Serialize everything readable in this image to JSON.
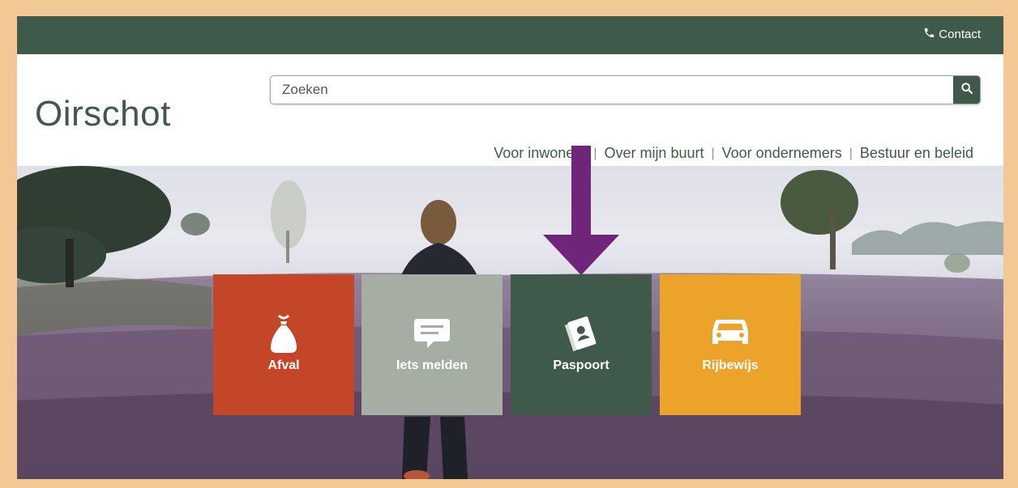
{
  "topbar": {
    "contact_label": "Contact",
    "contact_icon": "phone-icon",
    "background": "#3f5a4b"
  },
  "header": {
    "logo_text": "Oirschot",
    "search": {
      "placeholder": "Zoeken",
      "value": "",
      "button_icon": "search-icon"
    },
    "nav": [
      {
        "label": "Voor inwoners"
      },
      {
        "label": "Over mijn buurt"
      },
      {
        "label": "Voor ondernemers"
      },
      {
        "label": "Bestuur en beleid"
      }
    ],
    "nav_separator": "|"
  },
  "hero": {
    "tiles": [
      {
        "label": "Afval",
        "icon": "garbage-bag-icon",
        "color": "#c44628"
      },
      {
        "label": "Iets melden",
        "icon": "chat-bubble-icon",
        "color": "#a6ada3"
      },
      {
        "label": "Paspoort",
        "icon": "passport-icon",
        "color": "#3f5a4b"
      },
      {
        "label": "Rijbewijs",
        "icon": "car-icon",
        "color": "#eba329"
      }
    ],
    "annotation_arrow": {
      "color": "#6f2579",
      "points_to": "Paspoort"
    }
  },
  "colors": {
    "brand_green": "#3f5a4b",
    "frame_border": "#f2c994"
  }
}
